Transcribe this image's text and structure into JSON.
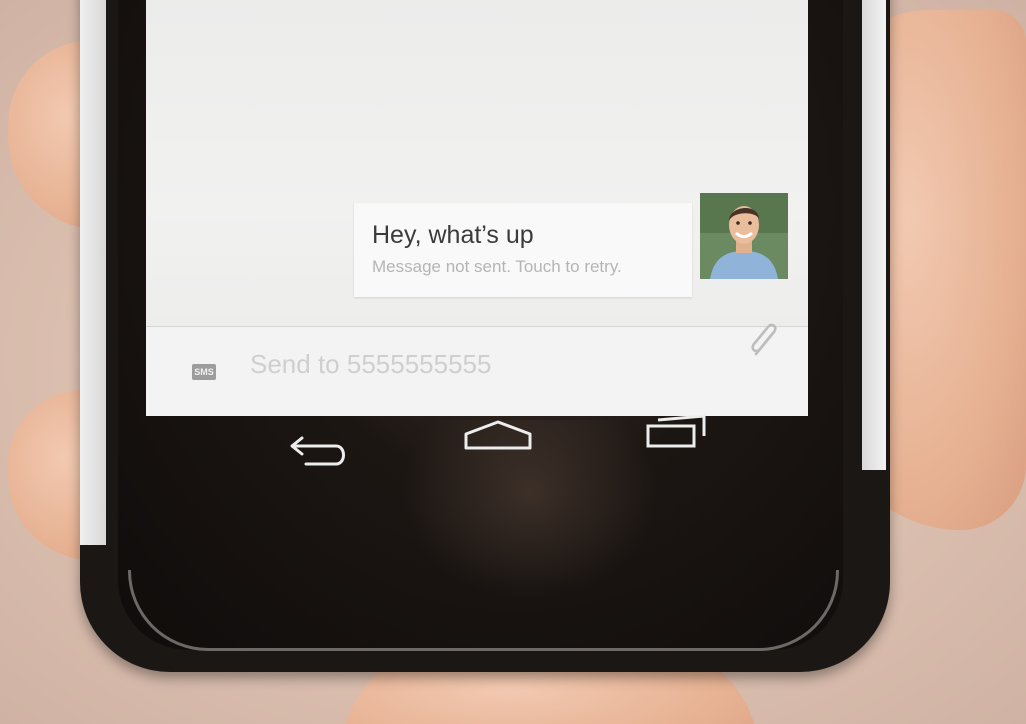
{
  "conversation": {
    "message": {
      "text": "Hey, what’s up",
      "status": "Message not sent. Touch to retry."
    },
    "contact_avatar": "contact-photo"
  },
  "compose": {
    "sms_badge": "SMS",
    "placeholder": "Send to 5555555555",
    "attach_icon": "paperclip-icon"
  },
  "navbar": {
    "back_icon": "back-icon",
    "home_icon": "home-icon",
    "recents_icon": "recent-apps-icon"
  },
  "colors": {
    "screen_background": "#efefee",
    "bubble_background": "#f9f9f9",
    "message_text": "#3b3b3b",
    "status_text": "#b5b5b5",
    "phone_body": "#1b1715"
  }
}
